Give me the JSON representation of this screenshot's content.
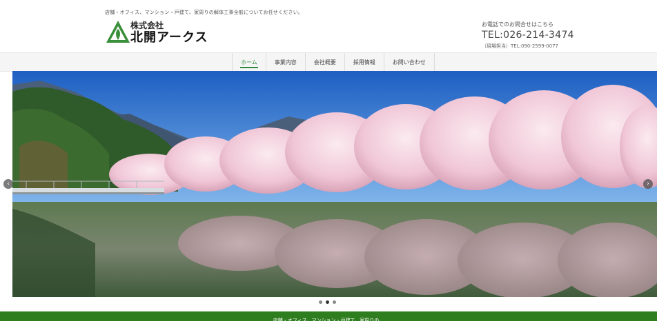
{
  "header": {
    "tagline": "店舗・オフィス、マンション・戸建て、家周りの解体工事全般についてお任せください。",
    "logo_sub": "株式会社",
    "logo_main": "北開アークス"
  },
  "contact": {
    "label": "お電話でのお問合せはこちら",
    "tel": "TEL:026-214-3474",
    "site": "（現場担当）TEL:090-2599-0077"
  },
  "nav": {
    "items": [
      {
        "label": "ホーム"
      },
      {
        "label": "事業内容"
      },
      {
        "label": "会社概要"
      },
      {
        "label": "採用情報"
      },
      {
        "label": "お問い合わせ"
      }
    ]
  },
  "slider": {
    "prev_icon": "chevron-left-icon",
    "next_icon": "chevron-right-icon",
    "prev_glyph": "‹",
    "next_glyph": "›",
    "slide_count": 3,
    "active_slide": 2
  },
  "footer": {
    "band_text": "店舗・オフィス、マンション・戸建て、家周りの、"
  },
  "colors": {
    "brand_green": "#2e7d1e",
    "nav_active": "#2b8a3e"
  }
}
